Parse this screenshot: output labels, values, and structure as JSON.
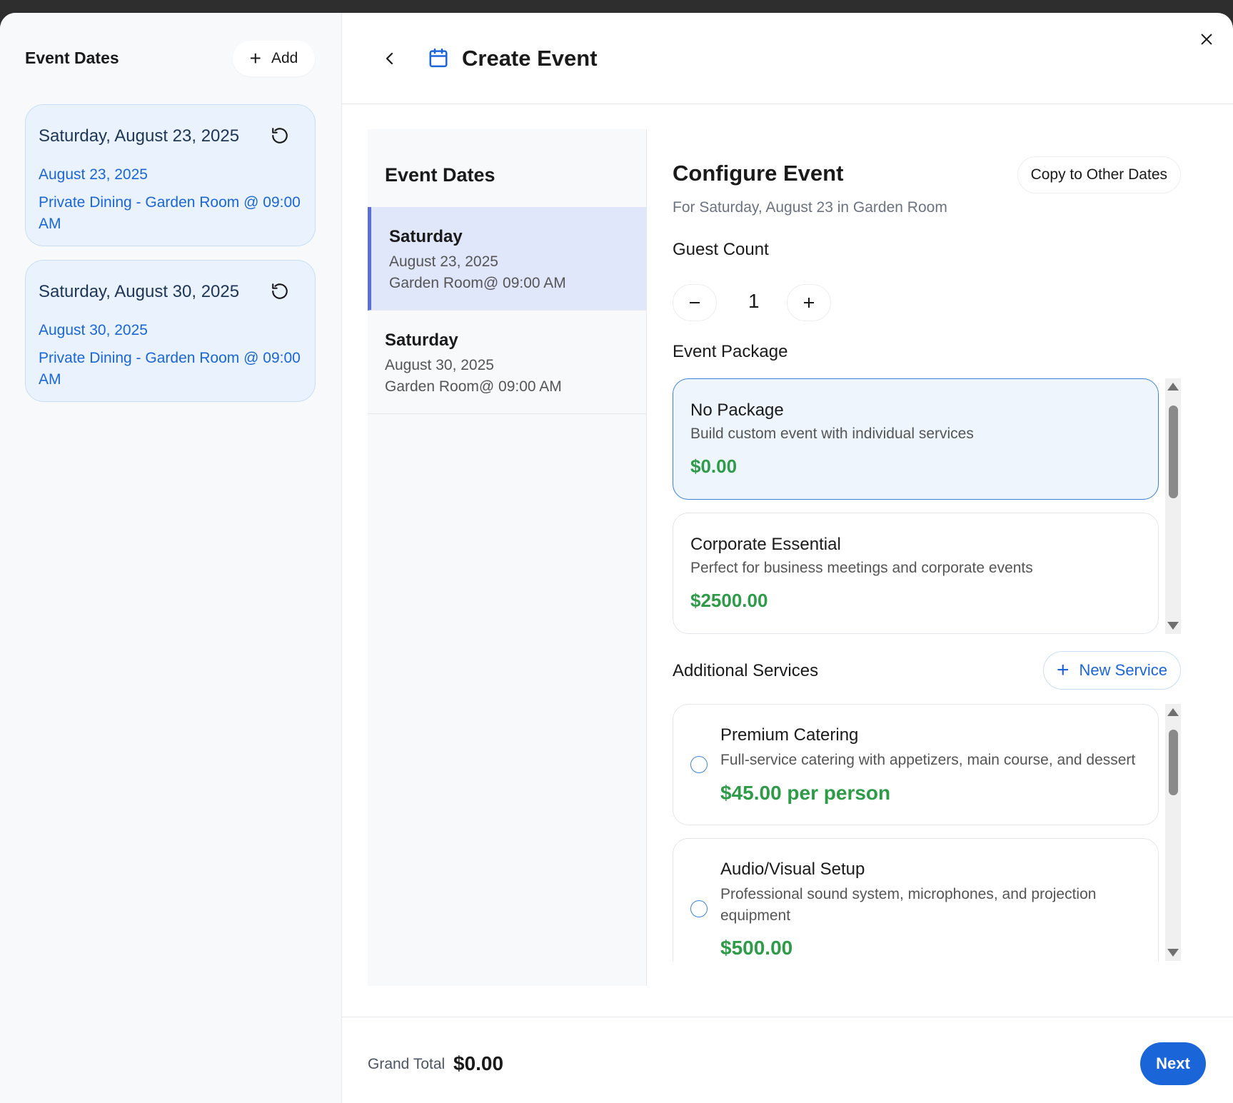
{
  "sidebar": {
    "title": "Event Dates",
    "add_label": "Add",
    "cards": [
      {
        "date": "Saturday, August 23, 2025",
        "sub_date": "August 23, 2025",
        "venue": "Private Dining - Garden Room @ 09:00 AM"
      },
      {
        "date": "Saturday, August 30, 2025",
        "sub_date": "August 30, 2025",
        "venue": "Private Dining - Garden Room @ 09:00 AM"
      }
    ]
  },
  "header": {
    "title": "Create Event"
  },
  "dates_list": {
    "title": "Event Dates",
    "items": [
      {
        "day": "Saturday",
        "date": "August 23, 2025",
        "room": "Garden Room@ 09:00 AM",
        "active": true
      },
      {
        "day": "Saturday",
        "date": "August 30, 2025",
        "room": "Garden Room@ 09:00 AM",
        "active": false
      }
    ]
  },
  "configure": {
    "title": "Configure Event",
    "copy_label": "Copy to Other Dates",
    "subtitle": "For Saturday, August 23 in Garden Room",
    "guest_count_label": "Guest Count",
    "guest_count": "1",
    "package_label": "Event Package",
    "packages": [
      {
        "name": "No Package",
        "description": "Build custom event with individual services",
        "price": "$0.00",
        "selected": true
      },
      {
        "name": "Corporate Essential",
        "description": "Perfect for business meetings and corporate events",
        "price": "$2500.00",
        "selected": false
      }
    ],
    "services_label": "Additional Services",
    "new_service_label": "New Service",
    "services": [
      {
        "name": "Premium Catering",
        "description": "Full-service catering with appetizers, main course, and dessert",
        "price": "$45.00 per person"
      },
      {
        "name": "Audio/Visual Setup",
        "description": "Professional sound system, microphones, and projection equipment",
        "price": "$500.00"
      }
    ]
  },
  "footer": {
    "grand_total_label": "Grand Total",
    "grand_total": "$0.00",
    "next_label": "Next"
  },
  "colors": {
    "accent": "#1a66d9",
    "price_green": "#2e9b48",
    "active_item_bg": "#e1e7fb",
    "active_item_border": "#5b6ee1"
  }
}
